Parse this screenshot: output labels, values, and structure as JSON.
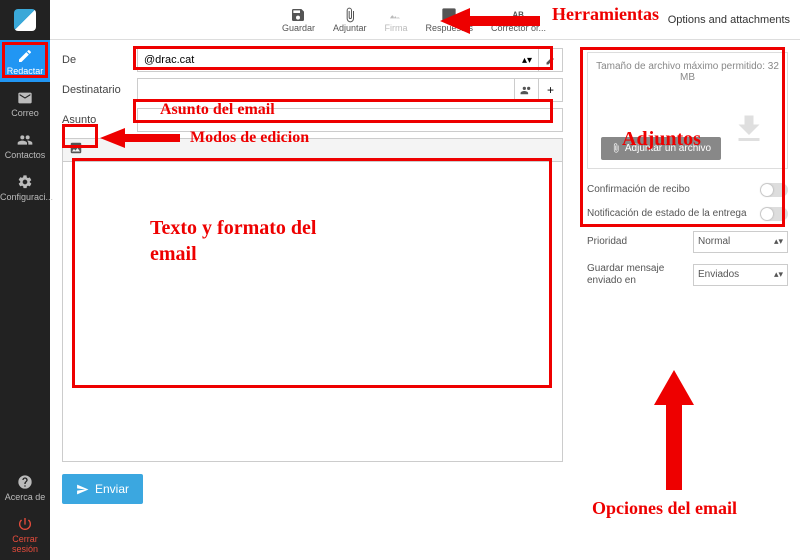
{
  "toolbar": {
    "save": "Guardar",
    "attach": "Adjuntar",
    "signature": "Firma",
    "responses": "Respuestas",
    "spellcheck": "Corrector or...",
    "options_attachments": "Options and attachments"
  },
  "sidebar": {
    "compose": "Redactar",
    "mail": "Correo",
    "contacts": "Contactos",
    "settings": "Configuraci...",
    "about": "Acerca de",
    "logout": "Cerrar sesión"
  },
  "fields": {
    "from_label": "De",
    "from_value": "@drac.cat",
    "to_label": "Destinatario",
    "subject_label": "Asunto"
  },
  "send_label": "Enviar",
  "attachments": {
    "max_size": "Tamaño de archivo máximo permitido: 32 MB",
    "attach_button": "Adjuntar un archivo"
  },
  "options": {
    "receipt": "Confirmación de recibo",
    "dsn": "Notificación de estado de la entrega",
    "priority_label": "Prioridad",
    "priority_value": "Normal",
    "save_sent_label": "Guardar mensaje enviado en",
    "save_sent_value": "Enviados"
  },
  "annotations": {
    "tools": "Herramientas",
    "subject": "Asunto del email",
    "modes": "Modos de edicion",
    "body": "Texto y formato del email",
    "attachments": "Adjuntos",
    "email_options": "Opciones del email"
  }
}
